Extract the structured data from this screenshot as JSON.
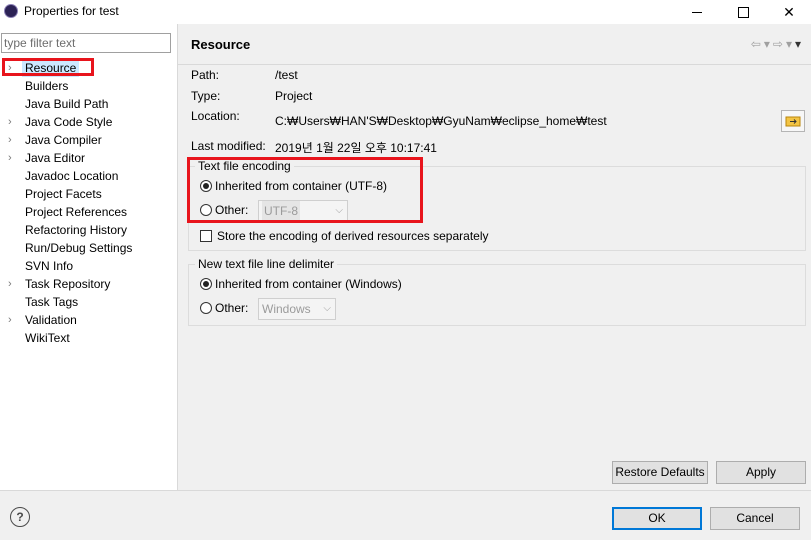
{
  "window": {
    "title": "Properties for test"
  },
  "filter": {
    "placeholder": "type filter text"
  },
  "tree": {
    "items": [
      {
        "label": "Resource",
        "expandable": true,
        "selected": true
      },
      {
        "label": "Builders",
        "expandable": false
      },
      {
        "label": "Java Build Path",
        "expandable": false
      },
      {
        "label": "Java Code Style",
        "expandable": true
      },
      {
        "label": "Java Compiler",
        "expandable": true
      },
      {
        "label": "Java Editor",
        "expandable": true
      },
      {
        "label": "Javadoc Location",
        "expandable": false
      },
      {
        "label": "Project Facets",
        "expandable": false
      },
      {
        "label": "Project References",
        "expandable": false
      },
      {
        "label": "Refactoring History",
        "expandable": false
      },
      {
        "label": "Run/Debug Settings",
        "expandable": false
      },
      {
        "label": "SVN Info",
        "expandable": false
      },
      {
        "label": "Task Repository",
        "expandable": true
      },
      {
        "label": "Task Tags",
        "expandable": false
      },
      {
        "label": "Validation",
        "expandable": true
      },
      {
        "label": "WikiText",
        "expandable": false
      }
    ]
  },
  "page": {
    "title": "Resource",
    "path_label": "Path:",
    "path_value": "/test",
    "type_label": "Type:",
    "type_value": "Project",
    "location_label": "Location:",
    "location_value": "C:₩Users₩HAN'S₩Desktop₩GyuNam₩eclipse_home₩test",
    "modified_label": "Last modified:",
    "modified_value": "2019년 1월 22일 오후 10:17:41"
  },
  "encoding": {
    "group_title": "Text file encoding",
    "inherited_label": "Inherited from container (UTF-8)",
    "other_label": "Other:",
    "other_value": "UTF-8",
    "store_label": "Store the encoding of derived resources separately"
  },
  "delimiter": {
    "group_title": "New text file line delimiter",
    "inherited_label": "Inherited from container (Windows)",
    "other_label": "Other:",
    "other_value": "Windows"
  },
  "buttons": {
    "restore_defaults": "Restore Defaults",
    "apply": "Apply",
    "ok": "OK",
    "cancel": "Cancel"
  },
  "icons": {
    "help": "?",
    "nav_back": "⇦",
    "nav_forward": "⇨",
    "dropdown": "▾"
  },
  "colors": {
    "highlight_annotation": "#e8141c",
    "selection": "#cce8ff",
    "default_button_border": "#0078d7"
  }
}
